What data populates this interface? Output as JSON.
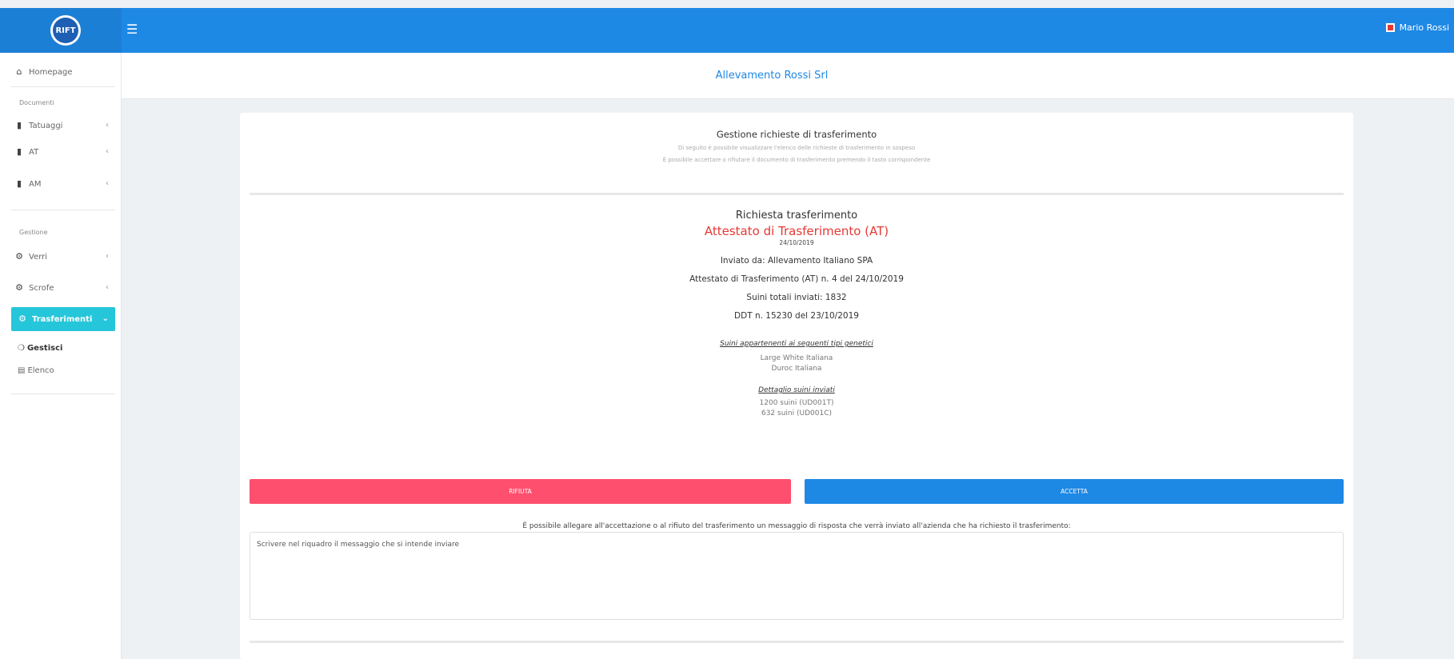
{
  "app": {
    "logo_text": "RIFT",
    "menu_icon": "hamburger-icon"
  },
  "user": {
    "name": "Mario Rossi",
    "icon": "flag-icon"
  },
  "company": {
    "name": "Allevamento Rossi Srl"
  },
  "sidebar": {
    "homepage": {
      "label": "Homepage",
      "icon": "home-icon"
    },
    "section_documenti": "Documenti",
    "documenti_items": [
      {
        "label": "Tatuaggi",
        "icon": "document-icon"
      },
      {
        "label": "AT",
        "icon": "document-icon"
      },
      {
        "label": "AM",
        "icon": "document-icon"
      }
    ],
    "section_gestione": "Gestione",
    "gestione_items": [
      {
        "label": "Verri",
        "icon": "gear-icon"
      },
      {
        "label": "Scrofe",
        "icon": "gear-icon"
      },
      {
        "label": "Trasferimenti",
        "icon": "gear-icon",
        "active": true
      }
    ],
    "sub_items": [
      {
        "label": "Gestisci",
        "icon": "circle-icon",
        "active": true
      },
      {
        "label": "Elenco",
        "icon": "list-icon"
      }
    ],
    "accent_color": "#26c6da"
  },
  "page": {
    "title": "Gestione richieste di trasferimento",
    "subtitle_1": "Di seguito è possibile visualizzare l'elenco delle richieste di trasferimento in sospeso",
    "subtitle_2": "È possibile accettare o rifiutare il documento di trasferimento premendo il tasto corrispondente"
  },
  "request": {
    "heading": "Richiesta trasferimento",
    "type": "Attestato di Trasferimento (AT)",
    "date": "24/10/2019",
    "sent_by": "Inviato da: Allevamento Italiano SPA",
    "document": "Attestato di Trasferimento (AT) n. 4 del 24/10/2019",
    "total_pigs": "Suini totali inviati: 1832",
    "ddt": "DDT n. 15230 del 23/10/2019",
    "genetic_types_heading": "Suini appartenenti ai seguenti tipi genetici",
    "genetic_types": [
      "Large White Italiana",
      "Duroc Italiana"
    ],
    "details_heading": "Dettaglio suini inviati",
    "details": [
      "1200 suini (UD001T)",
      "632 suini (UD001C)"
    ],
    "type_color": "#e53935"
  },
  "actions": {
    "refuse_label": "RIFIUTA",
    "accept_label": "ACCETTA",
    "refuse_color": "#ff4f6e",
    "accept_color": "#1e88e5"
  },
  "message": {
    "label": "È possibile allegare all'accettazione o al rifiuto del trasferimento un messaggio di risposta che verrà inviato all'azienda che ha richiesto il trasferimento:",
    "placeholder": "Scrivere nel riquadro il messaggio che si intende inviare",
    "value": ""
  }
}
